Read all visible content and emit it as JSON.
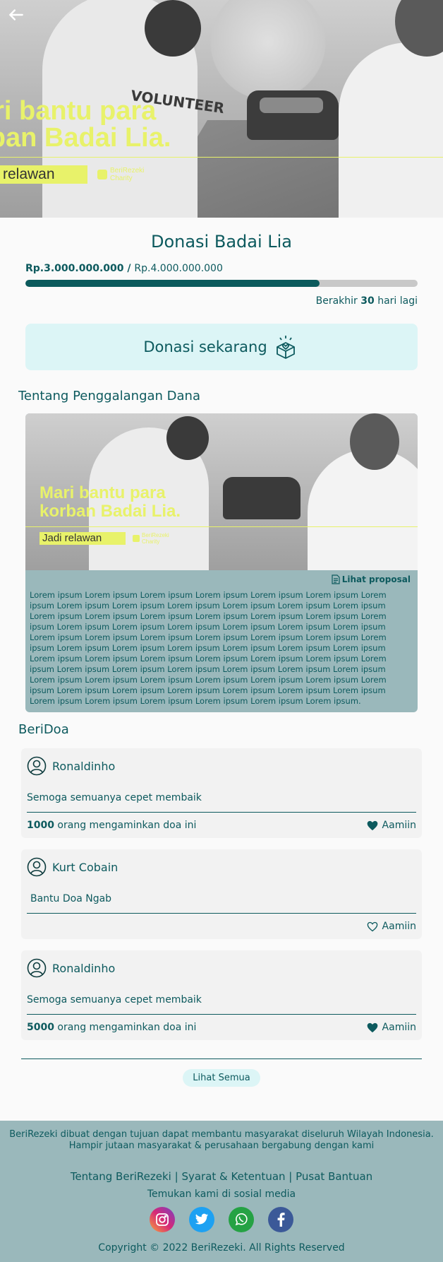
{
  "hero": {
    "headline_line1": "ari bantu para",
    "headline_line2": "rban Badai Lia.",
    "cta": "relawan",
    "brand_line1": "BeriRezeki",
    "brand_line2": "Charity",
    "shirt_text": "VOLUNTEER"
  },
  "campaign": {
    "title": "Donasi Badai Lia",
    "collected": "Rp.3.000.000.000",
    "separator": " / ",
    "target": "Rp.4.000.000.000",
    "progress_fraction": 0.75,
    "ends_prefix": "Berakhir ",
    "ends_days": "30",
    "ends_suffix": " hari lagi",
    "donate_label": "Donasi sekarang"
  },
  "about": {
    "section_title": "Tentang Penggalangan Dana",
    "image": {
      "headline_line1": "Mari bantu para",
      "headline_line2": "korban Badai Lia.",
      "cta": "Jadi relawan",
      "brand_line1": "BeriRezeki",
      "brand_line2": "Charity"
    },
    "proposal_label": "Lihat proposal",
    "description": "Lorem ipsum Lorem ipsum Lorem ipsum Lorem ipsum Lorem ipsum Lorem ipsum Lorem ipsum Lorem ipsum Lorem ipsum Lorem ipsum Lorem ipsum Lorem ipsum Lorem ipsum Lorem ipsum Lorem ipsum Lorem ipsum Lorem ipsum Lorem ipsum Lorem ipsum Lorem ipsum Lorem ipsum Lorem ipsum Lorem ipsum Lorem ipsum Lorem ipsum Lorem ipsum Lorem ipsum Lorem ipsum Lorem ipsum Lorem ipsum Lorem ipsum Lorem ipsum Lorem ipsum Lorem ipsum Lorem ipsum Lorem ipsum Lorem ipsum Lorem ipsum Lorem ipsum Lorem ipsum Lorem ipsum Lorem ipsum Lorem ipsum Lorem ipsum Lorem ipsum Lorem ipsum Lorem ipsum Lorem ipsum Lorem ipsum Lorem ipsum Lorem ipsum Lorem ipsum Lorem ipsum Lorem ipsum Lorem ipsum Lorem ipsum Lorem ipsum Lorem ipsum Lorem ipsum Lorem ipsum Lorem ipsum Lorem ipsum Lorem ipsum Lorem ipsum Lorem ipsum Lorem ipsum Lorem ipsum Lorem ipsum Lorem ipsum Lorem ipsum Lorem ipsum."
  },
  "beridoa": {
    "section_title": "BeriDoa",
    "amin_label": "Aamiin",
    "count_suffix": " orang mengaminkan  doa ini",
    "items": [
      {
        "name": "Ronaldinho",
        "text": "Semoga semuanya cepet membaik",
        "count": "1000",
        "liked": true
      },
      {
        "name": "Kurt Cobain",
        "text": "Bantu Doa Ngab",
        "count": "",
        "liked": false
      },
      {
        "name": "Ronaldinho",
        "text": "Semoga semuanya cepet membaik",
        "count": "5000",
        "liked": true
      }
    ],
    "see_all_label": "Lihat Semua"
  },
  "footer": {
    "desc_line1": "BeriRezeki dibuat dengan tujuan dapat membantu masyarakat diseluruh Wilayah Indonesia.",
    "desc_line2": "Hampir jutaan masyarakat & perusahaan bergabung dengan kami",
    "link_about": "Tentang BeriRezeki",
    "link_terms": "Syarat & Ketentuan",
    "link_help": "Pusat Bantuan",
    "link_sep": " | ",
    "social_title": "Temukan kami di sosial media",
    "socials": [
      {
        "name": "instagram-icon",
        "glyph": "◎",
        "color": "#c13584"
      },
      {
        "name": "twitter-icon",
        "glyph": "t",
        "color": "#1da1f2"
      },
      {
        "name": "whatsapp-icon",
        "glyph": "✆",
        "color": "#25a244"
      },
      {
        "name": "facebook-icon",
        "glyph": "f",
        "color": "#3b5998"
      }
    ],
    "copyright": "Copyright © 2022 BeriRezeki. All Rights Reserved"
  }
}
